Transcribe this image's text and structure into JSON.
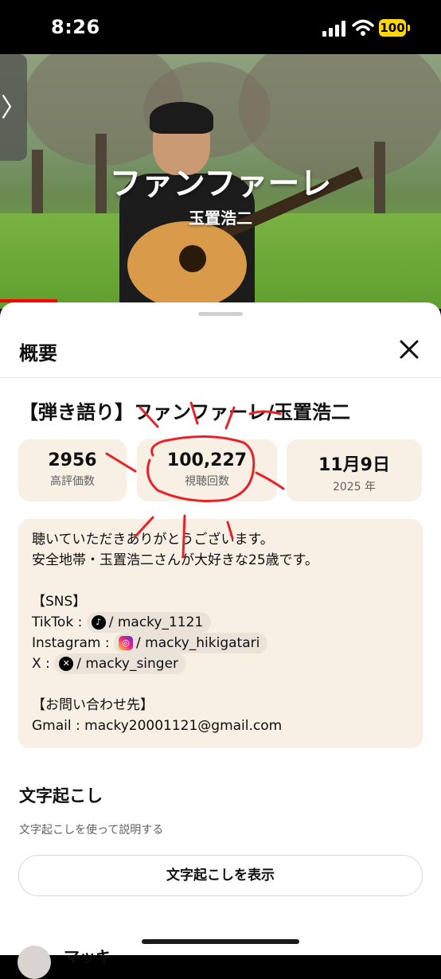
{
  "status_bar": {
    "time": "8:26",
    "battery": "100"
  },
  "video": {
    "overlay_title": "ファンファーレ",
    "overlay_subtitle": "玉置浩二",
    "collapse_glyph": "〉",
    "progress_fraction": 0.13
  },
  "sheet": {
    "title": "概要",
    "video_title": "【弾き語り】ファンファーレ/玉置浩二",
    "stats": [
      {
        "value": "2956",
        "label": "高評価数"
      },
      {
        "value": "100,227",
        "label": "視聴回数"
      },
      {
        "value": "11月9日",
        "label": "2025 年"
      }
    ],
    "description": {
      "line1": "聴いていただきありがとうございます。",
      "line2": "安全地帯・玉置浩二さんが大好きな25歳です。",
      "sns_header": "【SNS】",
      "tiktok_label": "TikTok :",
      "tiktok_handle": "/ macky_1121",
      "instagram_label": "Instagram :",
      "instagram_handle": "/ macky_hikigatari",
      "x_label": "X :",
      "x_handle": "/ macky_singer",
      "contact_header": "【お問い合わせ先】",
      "gmail": "Gmail : macky20001121@gmail.com"
    },
    "transcript": {
      "title": "文字起こし",
      "description": "文字起こしを使って説明する",
      "button": "文字起こしを表示"
    },
    "channel_partial": "マッキ"
  },
  "icons": {
    "signal": "cellular-signal-icon",
    "wifi": "wifi-icon",
    "close": "close-icon",
    "tiktok": "tiktok-icon",
    "instagram": "instagram-icon",
    "x": "x-icon"
  },
  "colors": {
    "annotation_red": "#e8222a",
    "card_bg": "#f8efe5",
    "battery": "#ffd60a"
  }
}
